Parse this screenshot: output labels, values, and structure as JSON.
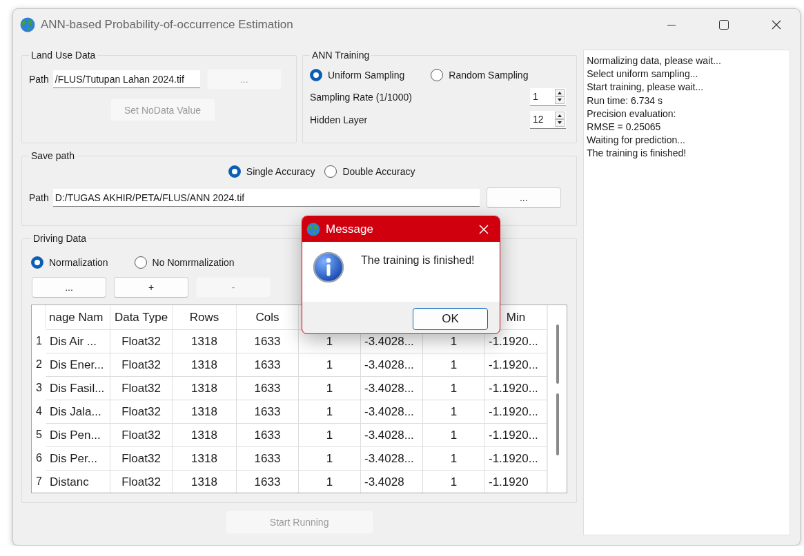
{
  "window": {
    "title": "ANN-based Probability-of-occurrence Estimation"
  },
  "land_use_data": {
    "title": "Land Use Data",
    "path_label": "Path",
    "path_value": "/FLUS/Tutupan Lahan 2024.tif",
    "browse_button": {
      "label": "...",
      "disabled": true
    },
    "nodata_button": {
      "label": "Set NoData Value",
      "disabled": true
    }
  },
  "ann_training": {
    "title": "ANN Training",
    "sampling": [
      {
        "label": "Uniform Sampling",
        "selected": true
      },
      {
        "label": "Random Sampling",
        "selected": false
      }
    ],
    "spins": [
      {
        "label": "Sampling Rate (1/1000)",
        "value": "1"
      },
      {
        "label": "Hidden Layer",
        "value": "12"
      }
    ]
  },
  "save_path": {
    "title": "Save path",
    "accuracy": [
      {
        "label": "Single Accuracy",
        "selected": true
      },
      {
        "label": "Double Accuracy",
        "selected": false
      }
    ],
    "path_label": "Path",
    "path_value": "D:/TUGAS AKHIR/PETA/FLUS/ANN 2024.tif",
    "browse_button": {
      "label": "...",
      "disabled": false
    }
  },
  "driving_data": {
    "title": "Driving Data",
    "normalization": [
      {
        "label": "Normalization",
        "selected": true
      },
      {
        "label": "No Nomrmalization",
        "selected": false
      }
    ],
    "buttons": [
      {
        "label": "...",
        "disabled": false
      },
      {
        "label": "+",
        "disabled": false
      },
      {
        "label": "-",
        "disabled": true
      }
    ],
    "table": {
      "columns": [
        "nage Nam",
        "Data Type",
        "Rows",
        "Cols",
        null,
        null,
        null,
        "Min"
      ],
      "rows": [
        {
          "number": "1",
          "cells": [
            "Dis Air ...",
            "Float32",
            "1318",
            "1633",
            "1",
            "-3.4028...",
            "1",
            "-1.1920..."
          ]
        },
        {
          "number": "2",
          "cells": [
            "Dis Ener...",
            "Float32",
            "1318",
            "1633",
            "1",
            "-3.4028...",
            "1",
            "-1.1920..."
          ]
        },
        {
          "number": "3",
          "cells": [
            "Dis Fasil...",
            "Float32",
            "1318",
            "1633",
            "1",
            "-3.4028...",
            "1",
            "-1.1920..."
          ]
        },
        {
          "number": "4",
          "cells": [
            "Dis Jala...",
            "Float32",
            "1318",
            "1633",
            "1",
            "-3.4028...",
            "1",
            "-1.1920..."
          ]
        },
        {
          "number": "5",
          "cells": [
            "Dis Pen...",
            "Float32",
            "1318",
            "1633",
            "1",
            "-3.4028...",
            "1",
            "-1.1920..."
          ]
        },
        {
          "number": "6",
          "cells": [
            "Dis Per...",
            "Float32",
            "1318",
            "1633",
            "1",
            "-3.4028...",
            "1",
            "-1.1920..."
          ]
        },
        {
          "number": "7",
          "cells": [
            "Distanc",
            "Float32",
            "1318",
            "1633",
            "1",
            "-3.4028",
            "1",
            "-1.1920"
          ]
        }
      ]
    }
  },
  "start_button": {
    "label": "Start Running",
    "disabled": true
  },
  "log": [
    "Normalizing data, please wait...",
    "Select uniform sampling...",
    "Start training, please wait...",
    "Run time: 6.734 s",
    "Precision evaluation:",
    "RMSE = 0.25065",
    "Waiting for prediction...",
    "The training is finished!"
  ],
  "dialog": {
    "title": "Message",
    "message": "The training is finished!",
    "ok_button": "OK"
  }
}
